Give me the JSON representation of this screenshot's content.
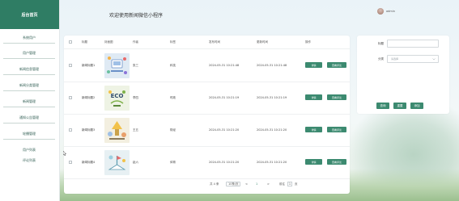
{
  "sidebar": {
    "title": "后台首页",
    "items": [
      {
        "label": "系统用户"
      },
      {
        "label": "用户管理"
      },
      {
        "label": "新闻信息管理"
      },
      {
        "label": "新闻分类管理"
      },
      {
        "label": "新闻管理"
      },
      {
        "label": "通知公告管理"
      },
      {
        "label": "轮播管理"
      },
      {
        "label": "用户列表"
      },
      {
        "label": "评论列表"
      }
    ]
  },
  "header": {
    "welcome": "欢迎使用新闻微信小程序",
    "username": "admin"
  },
  "table": {
    "headers": [
      "标题",
      "封面图",
      "作者",
      "标签",
      "发布时间",
      "更新时间",
      "操作"
    ],
    "rows": [
      {
        "title": "新闻标题1",
        "author": "张三",
        "tag": "科技",
        "publish_time": "2024-05-31 10:21:48",
        "update_time": "2024-05-31 10:21:48",
        "thumb_colors": [
          "#dfeaf4",
          "#6a90c8"
        ]
      },
      {
        "title": "新闻标题2",
        "author": "李四",
        "tag": "时政",
        "publish_time": "2024-05-31 10:21:19",
        "update_time": "2024-05-31 10:21:19",
        "thumb_colors": [
          "#eef3e4",
          "#7fb24a"
        ]
      },
      {
        "title": "新闻标题3",
        "author": "王五",
        "tag": "财经",
        "publish_time": "2024-05-31 10:21:20",
        "update_time": "2024-05-31 10:21:20",
        "thumb_colors": [
          "#f3efe0",
          "#caa24a"
        ]
      },
      {
        "title": "新闻标题4",
        "author": "赵六",
        "tag": "体育",
        "publish_time": "2024-05-31 10:21:20",
        "update_time": "2024-05-31 10:21:20",
        "thumb_colors": [
          "#e7f0f3",
          "#5b9bb0"
        ]
      }
    ],
    "action_labels": {
      "detail": "详情",
      "comment": "查看评论"
    }
  },
  "pagination": {
    "total": "共 4 条",
    "page_size": "10条/页",
    "prev": "<",
    "current": "1",
    "next": ">",
    "goto_label": "前往",
    "goto_value": "1",
    "page_suffix": "页"
  },
  "search": {
    "title_label": "标题",
    "title_placeholder": "",
    "category_label": "分类",
    "category_placeholder": "请选择",
    "query_label": "查询",
    "reset_label": "重置",
    "add_label": "添加"
  },
  "colors": {
    "brand": "#2f7d64",
    "button": "#3c8a70"
  }
}
